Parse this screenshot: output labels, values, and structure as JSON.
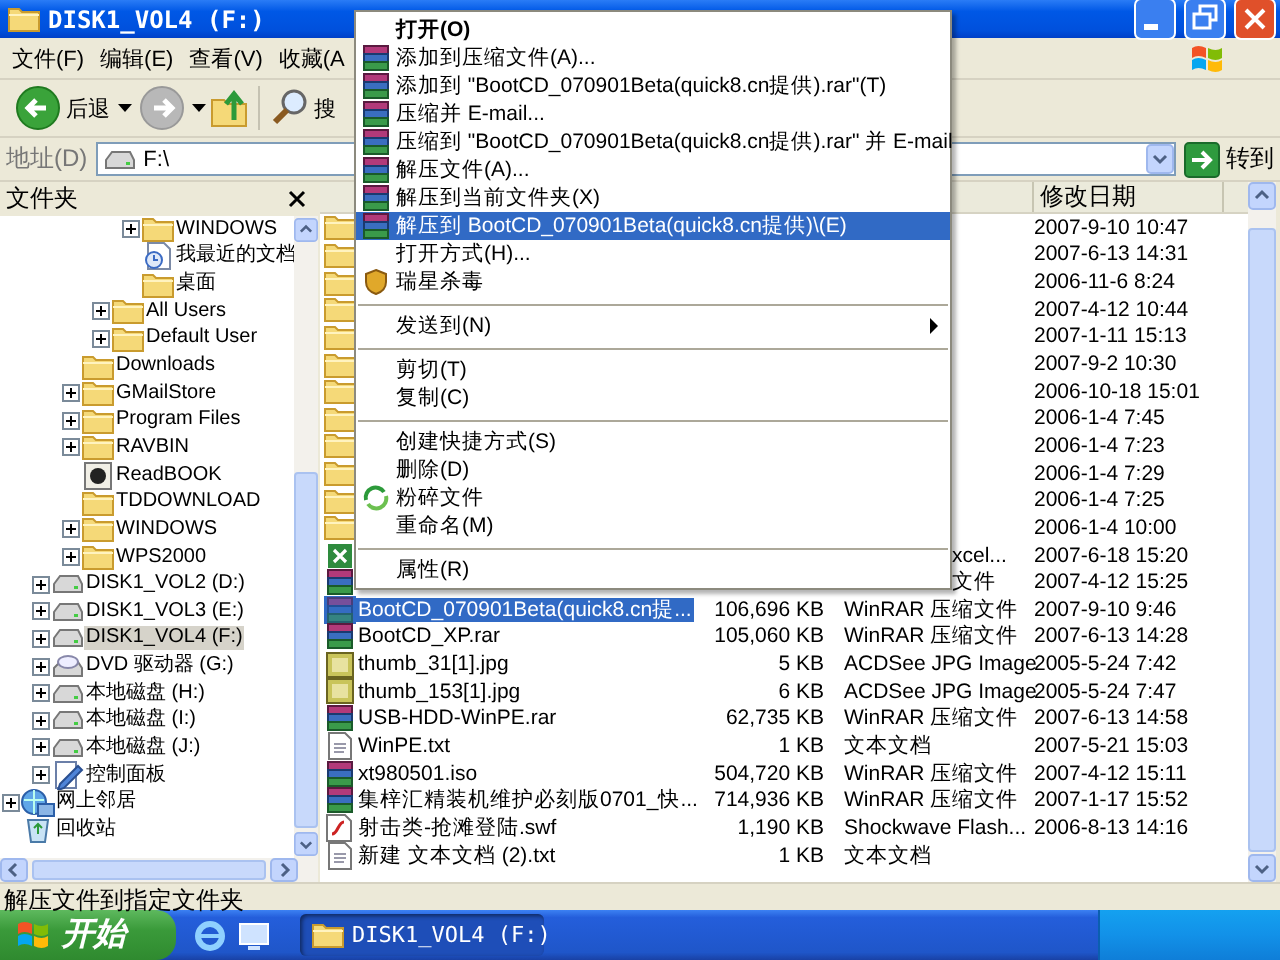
{
  "window": {
    "title": "DISK1_VOL4 (F:)"
  },
  "menu_bar": [
    "文件(F)",
    "编辑(E)",
    "查看(V)",
    "收藏(A"
  ],
  "toolbar": [
    {
      "kind": "back",
      "label": "后退",
      "disabled": false
    },
    {
      "kind": "forward",
      "disabled": true
    },
    {
      "kind": "up"
    },
    {
      "kind": "search",
      "label": "搜"
    }
  ],
  "address_bar": {
    "label": "地址(D)",
    "value": "F:\\",
    "go_label": "转到"
  },
  "folders_pane": {
    "title": "文件夹",
    "tree": [
      {
        "children": [
          {
            "children": [
              {
                "children": [
                  {
                    "children": [
                      {
                        "label": "WINDOWS",
                        "kind": "folder",
                        "collapsed": true,
                        "selected": false
                      },
                      {
                        "label": "我最近的文档",
                        "kind": "recent",
                        "collapsed": false,
                        "selected": false
                      },
                      {
                        "label": "桌面",
                        "kind": "folder",
                        "collapsed": false,
                        "selected": false
                      }
                    ]
                  },
                  {
                    "label": "All Users",
                    "kind": "folder",
                    "collapsed": true,
                    "selected": false
                  },
                  {
                    "label": "Default User",
                    "kind": "folder",
                    "collapsed": true,
                    "selected": false
                  }
                ]
              },
              {
                "label": "Downloads",
                "kind": "folder",
                "collapsed": false,
                "selected": false
              },
              {
                "label": "GMailStore",
                "kind": "folder",
                "collapsed": true,
                "selected": false
              },
              {
                "label": "Program Files",
                "kind": "folder",
                "collapsed": true,
                "selected": false
              },
              {
                "label": "RAVBIN",
                "kind": "folder",
                "collapsed": true,
                "selected": false
              },
              {
                "label": "ReadBOOK",
                "kind": "disc",
                "collapsed": false,
                "selected": false
              },
              {
                "label": "TDDOWNLOAD",
                "kind": "folder",
                "collapsed": false,
                "selected": false
              },
              {
                "label": "WINDOWS",
                "kind": "folder",
                "collapsed": true,
                "selected": false
              },
              {
                "label": "WPS2000",
                "kind": "folder",
                "collapsed": true,
                "selected": false
              }
            ]
          },
          {
            "label": "DISK1_VOL2 (D:)",
            "kind": "drive",
            "collapsed": true,
            "selected": false
          },
          {
            "label": "DISK1_VOL3 (E:)",
            "kind": "drive",
            "collapsed": true,
            "selected": false
          },
          {
            "label": "DISK1_VOL4 (F:)",
            "kind": "drive",
            "collapsed": true,
            "selected": true
          },
          {
            "label": "DVD 驱动器 (G:)",
            "kind": "dvd",
            "collapsed": true,
            "selected": false
          },
          {
            "label": "本地磁盘 (H:)",
            "kind": "drive",
            "collapsed": true,
            "selected": false
          },
          {
            "label": "本地磁盘 (I:)",
            "kind": "drive",
            "collapsed": true,
            "selected": false
          },
          {
            "label": "本地磁盘 (J:)",
            "kind": "drive",
            "collapsed": true,
            "selected": false
          },
          {
            "label": "控制面板",
            "kind": "control_panel",
            "collapsed": true,
            "selected": false
          }
        ]
      },
      {
        "label": "网上邻居",
        "kind": "network",
        "collapsed": true,
        "selected": false
      },
      {
        "label": "回收站",
        "kind": "recycle",
        "collapsed": false,
        "selected": false
      }
    ]
  },
  "file_list": {
    "date_header": "修改日期",
    "rows": [
      {
        "kind": "folder",
        "date": "2007-9-10 10:47",
        "selected": false
      },
      {
        "kind": "folder",
        "date": "2007-6-13 14:31",
        "selected": false
      },
      {
        "kind": "folder",
        "date": "2006-11-6 8:24",
        "selected": false
      },
      {
        "kind": "folder",
        "date": "2007-4-12 10:44",
        "selected": false
      },
      {
        "kind": "folder",
        "date": "2007-1-11 15:13",
        "selected": false
      },
      {
        "kind": "folder",
        "date": "2007-9-2 10:30",
        "selected": false
      },
      {
        "kind": "folder",
        "date": "2006-10-18 15:01",
        "selected": false
      },
      {
        "kind": "folder",
        "date": "2006-1-4 7:45",
        "selected": false
      },
      {
        "kind": "folder",
        "date": "2006-1-4 7:23",
        "selected": false
      },
      {
        "kind": "folder",
        "date": "2006-1-4 7:29",
        "selected": false
      },
      {
        "kind": "folder",
        "date": "2006-1-4 7:25",
        "selected": false
      },
      {
        "kind": "folder",
        "date": "2006-1-4 10:00",
        "selected": false
      },
      {
        "kind": "spreadsheet",
        "type_tail": "xcel...",
        "date": "2007-6-18 15:20",
        "selected": false
      },
      {
        "kind": "archive",
        "type_tail": "文件",
        "date": "2007-4-12 15:25",
        "selected": false
      },
      {
        "kind": "archive",
        "name": "BootCD_070901Beta(quick8.cn提...",
        "size": "106,696 KB",
        "type": "WinRAR 压缩文件",
        "date": "2007-9-10 9:46",
        "selected": true
      },
      {
        "kind": "archive",
        "name": "BootCD_XP.rar",
        "size": "105,060 KB",
        "type": "WinRAR 压缩文件",
        "date": "2007-6-13 14:28",
        "selected": false
      },
      {
        "kind": "image",
        "name": "thumb_31[1].jpg",
        "size": "5 KB",
        "type": "ACDSee JPG Image",
        "date": "2005-5-24 7:42",
        "selected": false
      },
      {
        "kind": "image",
        "name": "thumb_153[1].jpg",
        "size": "6 KB",
        "type": "ACDSee JPG Image",
        "date": "2005-5-24 7:47",
        "selected": false
      },
      {
        "kind": "archive",
        "name": "USB-HDD-WinPE.rar",
        "size": "62,735 KB",
        "type": "WinRAR 压缩文件",
        "date": "2007-6-13 14:58",
        "selected": false
      },
      {
        "kind": "text",
        "name": "WinPE.txt",
        "size": "1 KB",
        "type": "文本文档",
        "date": "2007-5-21 15:03",
        "selected": false
      },
      {
        "kind": "archive",
        "name": "xt980501.iso",
        "size": "504,720 KB",
        "type": "WinRAR 压缩文件",
        "date": "2007-4-12 15:11",
        "selected": false
      },
      {
        "kind": "archive",
        "name": "集梓汇精装机维护必刻版0701_快...",
        "size": "714,936 KB",
        "type": "WinRAR 压缩文件",
        "date": "2007-1-17 15:52",
        "selected": false
      },
      {
        "kind": "flash",
        "name": "射击类-抢滩登陆.swf",
        "size": "1,190 KB",
        "type": "Shockwave Flash...",
        "date": "2006-8-13 14:16",
        "selected": false
      },
      {
        "kind": "text",
        "name": "新建 文本文档 (2).txt",
        "size": "1 KB",
        "type": "文本文档",
        "selected": false
      }
    ]
  },
  "context_menu": {
    "items": [
      {
        "kind": "item",
        "label": "打开(O)",
        "default": true,
        "submenu": false,
        "selected": false
      },
      {
        "kind": "archive",
        "label": "添加到压缩文件(A)...",
        "default": false,
        "submenu": false,
        "selected": false
      },
      {
        "kind": "archive",
        "label": "添加到 \"BootCD_070901Beta(quick8.cn提供).rar\"(T)",
        "default": false,
        "submenu": false,
        "selected": false
      },
      {
        "kind": "archive",
        "label": "压缩并 E-mail...",
        "default": false,
        "submenu": false,
        "selected": false
      },
      {
        "kind": "archive",
        "label": "压缩到 \"BootCD_070901Beta(quick8.cn提供).rar\" 并 E-mail",
        "default": false,
        "submenu": false,
        "selected": false
      },
      {
        "kind": "archive",
        "label": "解压文件(A)...",
        "default": false,
        "submenu": false,
        "selected": false
      },
      {
        "kind": "archive",
        "label": "解压到当前文件夹(X)",
        "default": false,
        "submenu": false,
        "selected": false
      },
      {
        "kind": "archive",
        "label": "解压到 BootCD_070901Beta(quick8.cn提供)\\(E)",
        "default": false,
        "submenu": false,
        "selected": true
      },
      {
        "kind": "item",
        "label": "打开方式(H)...",
        "default": false,
        "submenu": false,
        "selected": false
      },
      {
        "kind": "antivirus",
        "label": "瑞星杀毒",
        "default": false,
        "submenu": false,
        "selected": false
      },
      {
        "kind": "separator"
      },
      {
        "kind": "item",
        "label": "发送到(N)",
        "default": false,
        "submenu": true,
        "selected": false
      },
      {
        "kind": "separator"
      },
      {
        "kind": "item",
        "label": "剪切(T)",
        "default": false,
        "submenu": false,
        "selected": false
      },
      {
        "kind": "item",
        "label": "复制(C)",
        "default": false,
        "submenu": false,
        "selected": false
      },
      {
        "kind": "separator"
      },
      {
        "kind": "item",
        "label": "创建快捷方式(S)",
        "default": false,
        "submenu": false,
        "selected": false
      },
      {
        "kind": "item",
        "label": "删除(D)",
        "default": false,
        "submenu": false,
        "selected": false
      },
      {
        "kind": "shred",
        "label": "粉碎文件",
        "default": false,
        "submenu": false,
        "selected": false
      },
      {
        "kind": "item",
        "label": "重命名(M)",
        "default": false,
        "submenu": false,
        "selected": false
      },
      {
        "kind": "separator"
      },
      {
        "kind": "item",
        "label": "属性(R)",
        "default": false,
        "submenu": false,
        "selected": false
      }
    ]
  },
  "status_bar": {
    "text": "解压文件到指定文件夹"
  },
  "taskbar": {
    "start_label": "开始",
    "tasks": [
      {
        "label": "DISK1_VOL4 (F:)",
        "selected": true
      }
    ]
  }
}
